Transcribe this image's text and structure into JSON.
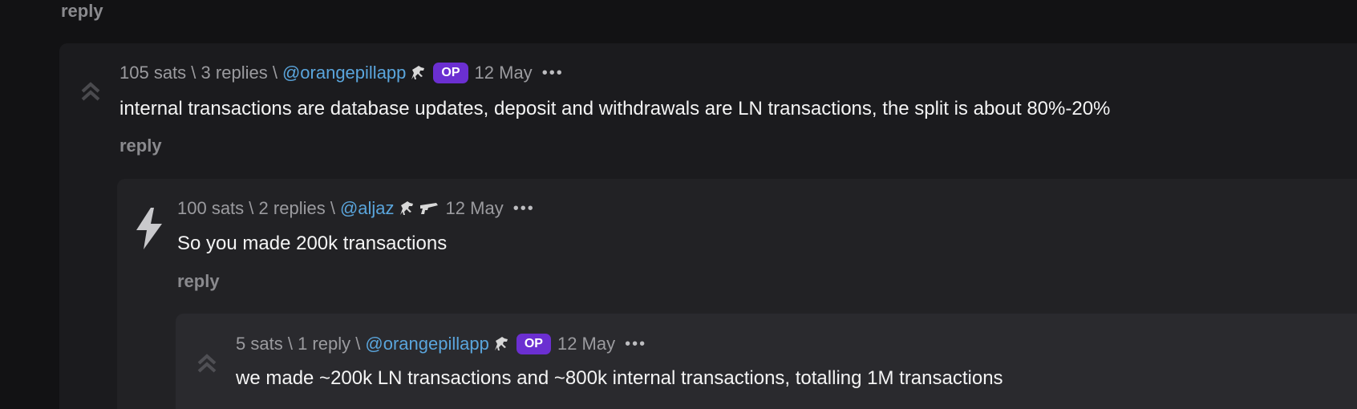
{
  "top": {
    "reply_label": "reply"
  },
  "comments": [
    {
      "sats": "105 sats",
      "sep1": "\\",
      "replies": "3 replies",
      "sep2": "\\",
      "user": "@orangepillapp",
      "op_badge": "OP",
      "date": "12 May",
      "more": "•••",
      "text": "internal transactions are database updates, deposit and withdrawals are LN transactions, the split is about 80%-20%",
      "reply_label": "reply",
      "vote_icon": "upvote-chevrons-icon"
    },
    {
      "sats": "100 sats",
      "sep1": "\\",
      "replies": "2 replies",
      "sep2": "\\",
      "user": "@aljaz",
      "date": "12 May",
      "more": "•••",
      "text": "So you made 200k transactions",
      "reply_label": "reply",
      "vote_icon": "lightning-bolt-icon"
    },
    {
      "sats": "5 sats",
      "sep1": "\\",
      "replies": "1 reply",
      "sep2": "\\",
      "user": "@orangepillapp",
      "op_badge": "OP",
      "date": "12 May",
      "more": "•••",
      "text": "we made ~200k LN transactions and ~800k internal transactions, totalling 1M transactions",
      "vote_icon": "upvote-chevrons-icon"
    }
  ],
  "colors": {
    "background": "#121214",
    "user_link": "#5aa5dc",
    "op_badge": "#6b2fd1",
    "muted": "#9b9b9f"
  }
}
